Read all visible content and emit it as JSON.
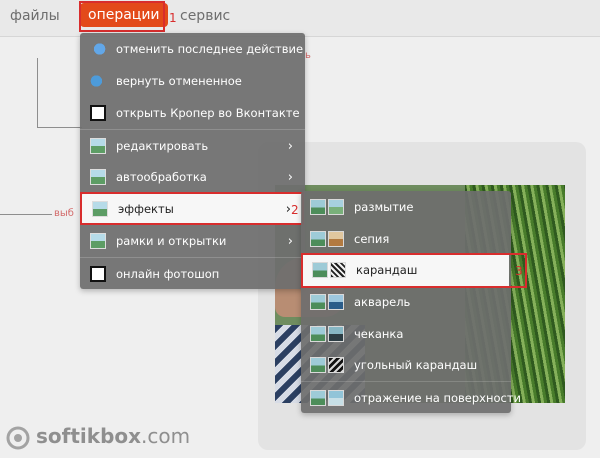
{
  "nav": {
    "items": [
      "файлы",
      "операции",
      "сервис"
    ],
    "active_index": 1
  },
  "annotations": {
    "n1": "1",
    "n2": "2",
    "n3": "3",
    "ghost1": "ь",
    "ghost2": "выб"
  },
  "menu": {
    "items": [
      {
        "label": "отменить последнее действие",
        "icon": "undo-icon",
        "submenu": false
      },
      {
        "label": "вернуть отмененное",
        "icon": "redo-icon",
        "submenu": false
      },
      {
        "label": "открыть Кропер во Вконтакте",
        "icon": "crop-icon",
        "submenu": false
      },
      {
        "label": "редактировать",
        "icon": "image-edit-icon",
        "submenu": true
      },
      {
        "label": "автообработка",
        "icon": "image-auto-icon",
        "submenu": true
      },
      {
        "label": "эффекты",
        "icon": "effects-icon",
        "submenu": true
      },
      {
        "label": "рамки и открытки",
        "icon": "frames-icon",
        "submenu": true
      },
      {
        "label": "онлайн фотошоп",
        "icon": "crop-icon",
        "submenu": false
      }
    ],
    "selected_index": 5,
    "arrow": "›"
  },
  "submenu": {
    "items": [
      {
        "label": "размытие",
        "icon": "blur-icon"
      },
      {
        "label": "сепия",
        "icon": "sepia-icon"
      },
      {
        "label": "карандаш",
        "icon": "pencil-icon"
      },
      {
        "label": "акварель",
        "icon": "watercolor-icon"
      },
      {
        "label": "чеканка",
        "icon": "emboss-icon"
      },
      {
        "label": "угольный карандаш",
        "icon": "charcoal-icon"
      },
      {
        "label": "отражение на поверхности",
        "icon": "reflection-icon"
      }
    ],
    "selected_index": 2
  },
  "logo": {
    "name": "softikbox",
    "tld": ".com"
  },
  "colors": {
    "accent": "#e34a1a",
    "annotation": "#d82d2d",
    "menu_bg": "#6e6e6e",
    "highlight_bg": "#f7f7f7"
  }
}
